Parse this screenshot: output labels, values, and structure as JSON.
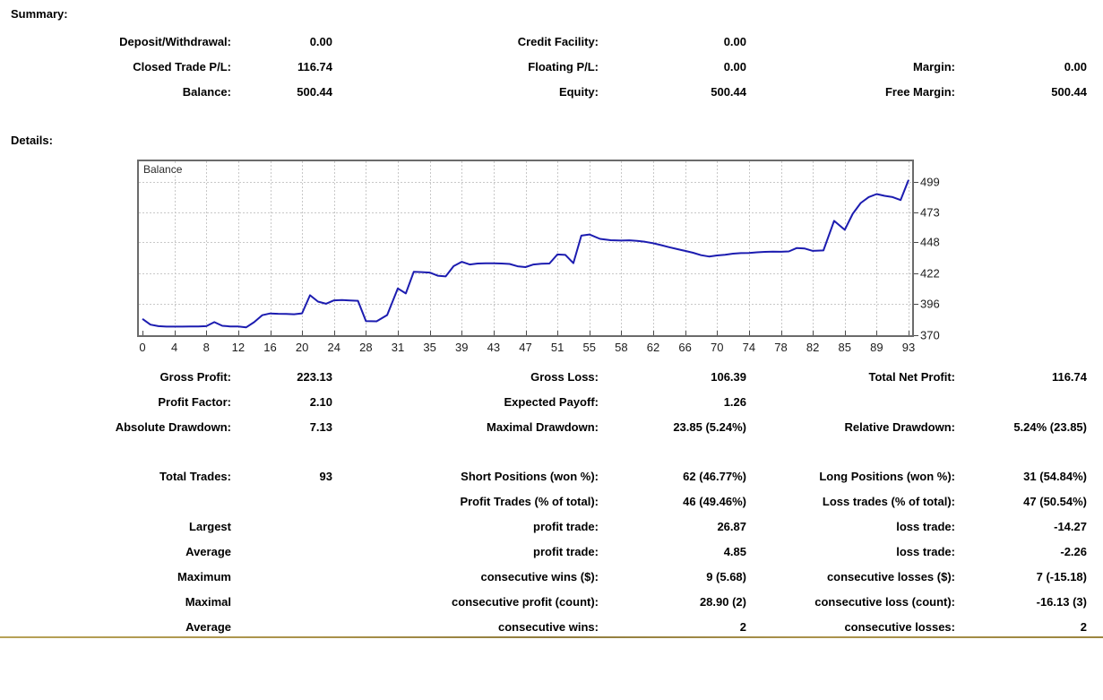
{
  "summary": {
    "heading": "Summary:",
    "rows": [
      [
        "Deposit/Withdrawal:",
        "0.00",
        "Credit Facility:",
        "0.00",
        "",
        ""
      ],
      [
        "Closed Trade P/L:",
        "116.74",
        "Floating P/L:",
        "0.00",
        "Margin:",
        "0.00"
      ],
      [
        "Balance:",
        "500.44",
        "Equity:",
        "500.44",
        "Free Margin:",
        "500.44"
      ]
    ]
  },
  "details": {
    "heading": "Details:",
    "stats_rows": [
      [
        "Gross Profit:",
        "223.13",
        "Gross Loss:",
        "106.39",
        "Total Net Profit:",
        "116.74"
      ],
      [
        "Profit Factor:",
        "2.10",
        "Expected Payoff:",
        "1.26",
        "",
        ""
      ],
      [
        "Absolute Drawdown:",
        "7.13",
        "Maximal Drawdown:",
        "23.85 (5.24%)",
        "Relative Drawdown:",
        "5.24% (23.85)"
      ]
    ],
    "trade_rows": [
      [
        "Total Trades:",
        "93",
        "Short Positions (won %):",
        "62 (46.77%)",
        "Long Positions (won %):",
        "31 (54.84%)"
      ],
      [
        "",
        "",
        "Profit Trades (% of total):",
        "46 (49.46%)",
        "Loss trades (% of total):",
        "47 (50.54%)"
      ],
      [
        "Largest",
        "",
        "profit trade:",
        "26.87",
        "loss trade:",
        "-14.27"
      ],
      [
        "Average",
        "",
        "profit trade:",
        "4.85",
        "loss trade:",
        "-2.26"
      ],
      [
        "Maximum",
        "",
        "consecutive wins ($):",
        "9 (5.68)",
        "consecutive losses ($):",
        "7 (-15.18)"
      ],
      [
        "Maximal",
        "",
        "consecutive profit (count):",
        "28.90 (2)",
        "consecutive loss (count):",
        "-16.13 (3)"
      ],
      [
        "Average",
        "",
        "consecutive wins:",
        "2",
        "consecutive losses:",
        "2"
      ]
    ]
  },
  "chart_data": {
    "type": "line",
    "title": "Balance",
    "series_label": "Balance",
    "xlabel": "",
    "ylabel": "",
    "x_ticks": [
      0,
      4,
      8,
      12,
      16,
      20,
      24,
      28,
      31,
      35,
      39,
      43,
      47,
      51,
      55,
      58,
      62,
      66,
      70,
      74,
      78,
      82,
      85,
      89,
      93
    ],
    "y_ticks": [
      370,
      396,
      422,
      448,
      473,
      499
    ],
    "xlim": [
      0,
      93
    ],
    "ylim": [
      370,
      516
    ],
    "grid": true,
    "legend_position": "top-left-inside",
    "values": [
      383.7,
      378.9,
      377.6,
      377.2,
      377.2,
      377.2,
      377.3,
      377.4,
      377.6,
      381.0,
      377.9,
      377.4,
      377.3,
      376.6,
      381.0,
      386.8,
      388.3,
      388.0,
      387.8,
      387.6,
      388.4,
      403.6,
      398.2,
      396.4,
      399.3,
      399.5,
      399.2,
      398.9,
      381.9,
      381.7,
      386.9,
      409.3,
      405.1,
      423.3,
      423.0,
      422.6,
      420.0,
      419.4,
      428.0,
      431.6,
      429.4,
      430.2,
      430.4,
      430.4,
      430.2,
      429.8,
      427.9,
      427.2,
      429.4,
      430.0,
      430.2,
      437.8,
      437.4,
      430.5,
      453.6,
      454.6,
      450.9,
      449.8,
      449.5,
      449.7,
      449.2,
      448.4,
      447.2,
      445.6,
      443.9,
      442.3,
      440.8,
      439.2,
      437.2,
      436.1,
      437.0,
      437.6,
      438.5,
      438.9,
      439.1,
      439.6,
      440.0,
      440.2,
      440.1,
      440.4,
      443.2,
      442.8,
      440.8,
      441.2,
      466.0,
      458.5,
      472.0,
      481.0,
      486.0,
      488.5,
      487.0,
      486.0,
      483.5,
      500.44
    ]
  },
  "colors": {
    "line": "#1c1cb0",
    "grid": "#c8c8c8",
    "chart_border": "#6b6b6b",
    "separator": "#a6904a",
    "tick": "#4a4a4a"
  }
}
